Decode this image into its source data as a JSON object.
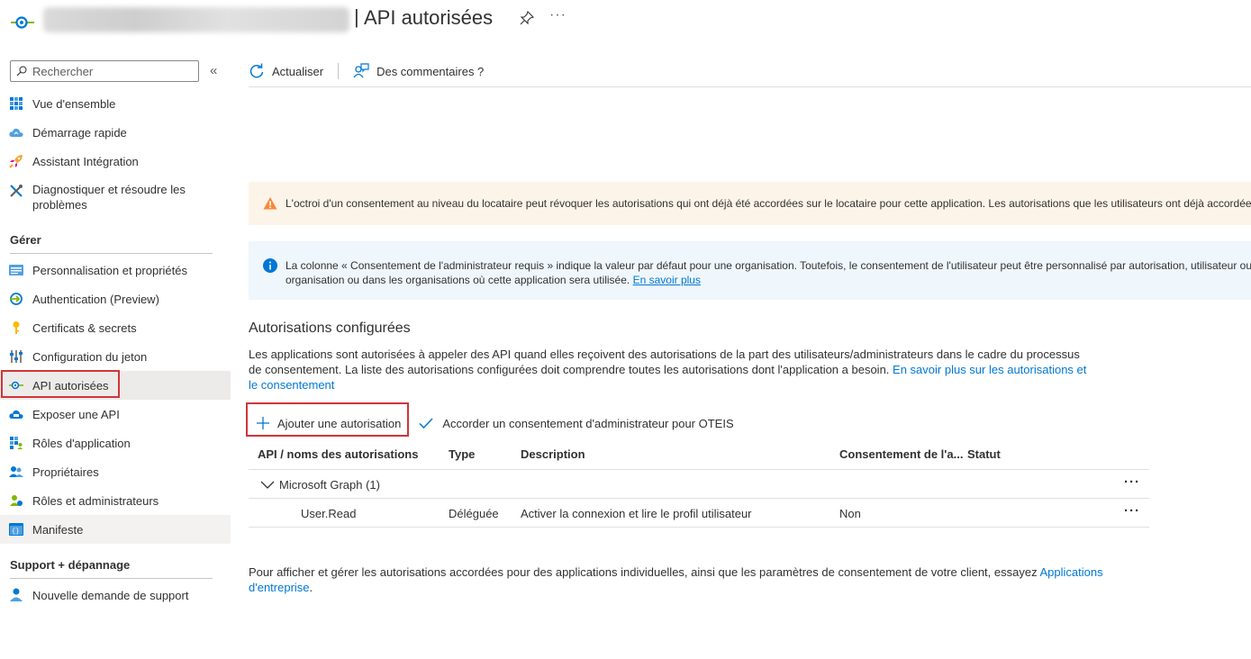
{
  "header": {
    "app_name_obscured": "SeriO - POSTFIX Oauth - PROD",
    "separator": "|",
    "title": "API autorisées",
    "more": "···"
  },
  "sidebar": {
    "search_placeholder": "Rechercher",
    "collapse": "«",
    "items": [
      {
        "label": "Vue d'ensemble",
        "icon": "overview-grid-icon"
      },
      {
        "label": "Démarrage rapide",
        "icon": "quickstart-cloud-icon"
      },
      {
        "label": "Assistant Intégration",
        "icon": "rocket-icon"
      },
      {
        "label": "Diagnostiquer et résoudre les problèmes",
        "icon": "wrench-icon"
      }
    ],
    "section_manage": "Gérer",
    "manage_items": [
      {
        "label": "Personnalisation et propriétés",
        "icon": "branding-icon"
      },
      {
        "label": "Authentication (Preview)",
        "icon": "authentication-icon"
      },
      {
        "label": "Certificats & secrets",
        "icon": "key-icon"
      },
      {
        "label": "Configuration du jeton",
        "icon": "token-config-icon"
      },
      {
        "label": "API autorisées",
        "icon": "api-permissions-icon"
      },
      {
        "label": "Exposer une API",
        "icon": "expose-api-cloud-icon"
      },
      {
        "label": "Rôles d'application",
        "icon": "app-roles-icon"
      },
      {
        "label": "Propriétaires",
        "icon": "owners-icon"
      },
      {
        "label": "Rôles et administrateurs",
        "icon": "roles-admins-icon"
      },
      {
        "label": "Manifeste",
        "icon": "manifest-icon"
      }
    ],
    "section_support": "Support + dépannage",
    "support_items": [
      {
        "label": "Nouvelle demande de support",
        "icon": "support-person-icon"
      }
    ]
  },
  "toolbar": {
    "refresh": "Actualiser",
    "feedback": "Des commentaires ?"
  },
  "banners": {
    "warning": "L'octroi d'un consentement au niveau du locataire peut révoquer les autorisations qui ont déjà été accordées sur le locataire pour cette application. Les autorisations que les utilisateurs ont déjà accordées",
    "info_line1": "La colonne « Consentement de l'administrateur requis » indique la valeur par défaut pour une organisation. Toutefois, le consentement de l'utilisateur peut être personnalisé par autorisation, utilisateur ou",
    "info_line2": "organisation ou dans les organisations où cette application sera utilisée.",
    "info_link": "En savoir plus"
  },
  "configured": {
    "heading": "Autorisations configurées",
    "description": "Les applications sont autorisées à appeler des API quand elles reçoivent des autorisations de la part des utilisateurs/administrateurs dans le cadre du processus de consentement. La liste des autorisations configurées doit comprendre toutes les autorisations dont l'application a besoin.",
    "learn_more_link": "En savoir plus sur les autorisations et le consentement",
    "add_permission": "Ajouter une autorisation",
    "grant_consent": "Accorder un consentement d'administrateur pour OTEIS"
  },
  "table": {
    "columns": [
      "API / noms des autorisations",
      "Type",
      "Description",
      "Consentement de l'a...",
      "Statut"
    ],
    "group": {
      "label": "Microsoft Graph (1)"
    },
    "rows": [
      {
        "name": "User.Read",
        "type": "Déléguée",
        "description": "Activer la connexion et lire le profil utilisateur",
        "admin_consent": "Non",
        "status": ""
      }
    ],
    "more": "···"
  },
  "footer": {
    "text": "Pour afficher et gérer les autorisations accordées pour des applications individuelles, ainsi que les paramètres de consentement de votre client, essayez",
    "link": "Applications d'entreprise",
    "end": "."
  },
  "colors": {
    "accent": "#0078d4",
    "highlight_outline": "#d13438",
    "warning_bg": "#fcf4e8",
    "info_bg": "#eff6fc"
  }
}
